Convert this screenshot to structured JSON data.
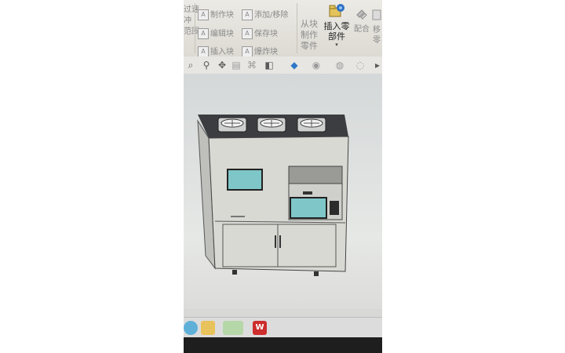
{
  "ribbon": {
    "col0": [
      "过速",
      "冲",
      "范围"
    ],
    "block_buttons": [
      "制作块",
      "编辑块",
      "插入块"
    ],
    "block_buttons2": [
      "添加/移除",
      "保存块",
      "爆炸块"
    ],
    "from_block": [
      "从块",
      "制作",
      "零件"
    ],
    "insert_part": [
      "插入零",
      "部件"
    ],
    "mate": "配合",
    "move": [
      "移",
      "零"
    ]
  },
  "toolbar": {
    "icons": [
      "search-icon",
      "zoom-icon",
      "pan-icon",
      "section-icon",
      "view-orient-icon",
      "display-style-icon",
      "hide-show-icon",
      "appearance-icon",
      "scene-icon"
    ]
  },
  "taskbar": {
    "apps": [
      "start-icon",
      "file-explorer-icon",
      "wechat-icon",
      "wps-icon"
    ],
    "wps_label": "W"
  },
  "model": {
    "fans": 3
  }
}
